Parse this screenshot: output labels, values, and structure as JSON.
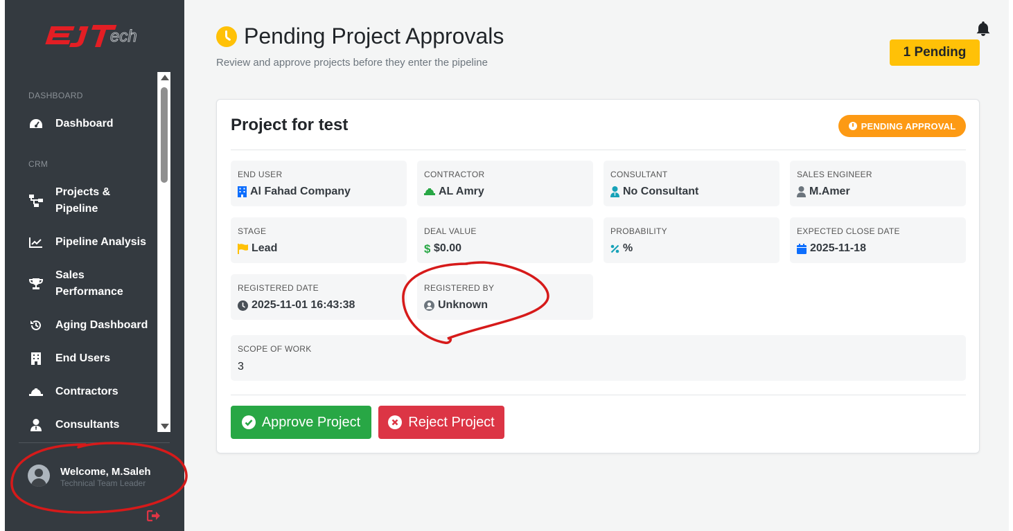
{
  "sidebar": {
    "logo_text": "EJTech",
    "sections": [
      {
        "label": "DASHBOARD"
      },
      {
        "label": "CRM"
      }
    ],
    "items": [
      {
        "label": "Dashboard",
        "icon": "speedometer-icon"
      },
      {
        "label": "Projects & Pipeline",
        "icon": "sitemap-icon"
      },
      {
        "label": "Pipeline Analysis",
        "icon": "chart-line-icon"
      },
      {
        "label": "Sales Performance",
        "icon": "trophy-icon"
      },
      {
        "label": "Aging Dashboard",
        "icon": "history-icon"
      },
      {
        "label": "End Users",
        "icon": "building-icon"
      },
      {
        "label": "Contractors",
        "icon": "hard-hat-icon"
      },
      {
        "label": "Consultants",
        "icon": "user-tie-icon"
      }
    ],
    "user": {
      "welcome": "Welcome, M.Saleh",
      "role": "Technical Team Leader"
    }
  },
  "header": {
    "title": "Pending Project Approvals",
    "subtitle": "Review and approve projects before they enter the pipeline",
    "pending_badge": "1 Pending"
  },
  "project": {
    "name": "Project for test",
    "status": "PENDING APPROVAL",
    "fields": [
      {
        "label": "END USER",
        "value": "Al Fahad Company",
        "icon": "building-icon",
        "color": "#0d6efd"
      },
      {
        "label": "CONTRACTOR",
        "value": "AL Amry",
        "icon": "hard-hat-icon",
        "color": "#28a745"
      },
      {
        "label": "CONSULTANT",
        "value": "No Consultant",
        "icon": "user-tie-icon",
        "color": "#17a2b8"
      },
      {
        "label": "SALES ENGINEER",
        "value": "M.Amer",
        "icon": "user-icon",
        "color": "#6c757d"
      },
      {
        "label": "STAGE",
        "value": "Lead",
        "icon": "flag-icon",
        "color": "#ffc107"
      },
      {
        "label": "DEAL VALUE",
        "value": "$0.00",
        "icon": "dollar-icon",
        "color": "#28a745"
      },
      {
        "label": "PROBABILITY",
        "value": "%",
        "icon": "percent-icon",
        "color": "#17a2b8"
      },
      {
        "label": "EXPECTED CLOSE DATE",
        "value": "2025-11-18",
        "icon": "calendar-icon",
        "color": "#0d6efd"
      },
      {
        "label": "REGISTERED DATE",
        "value": "2025-11-01 16:43:38",
        "icon": "clock-icon",
        "color": "#495057"
      },
      {
        "label": "REGISTERED BY",
        "value": "Unknown",
        "icon": "user-circle-icon",
        "color": "#6c757d"
      }
    ],
    "scope": {
      "label": "SCOPE OF WORK",
      "value": "3"
    },
    "actions": {
      "approve_label": "Approve Project",
      "reject_label": "Reject Project"
    }
  },
  "colors": {
    "sidebar_bg": "#343a40",
    "warning": "#ffc107",
    "status_orange": "#fd9a14",
    "success": "#28a745",
    "danger": "#dc3545",
    "annotation_red": "#d61a1a"
  }
}
